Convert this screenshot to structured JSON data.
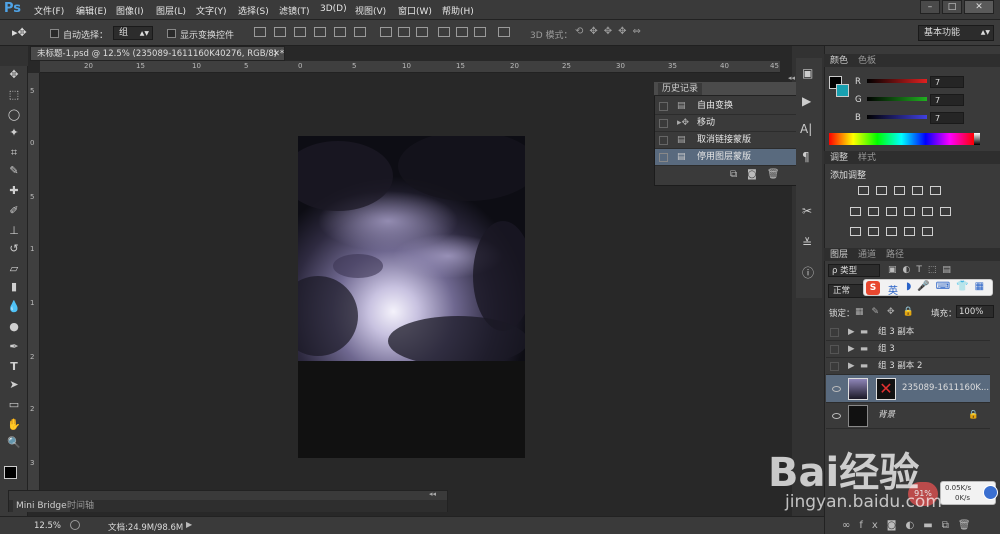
{
  "app": {
    "logo": "Ps"
  },
  "menubar": {
    "items": [
      "文件(F)",
      "编辑(E)",
      "图像(I)",
      "图层(L)",
      "文字(Y)",
      "选择(S)",
      "滤镜(T)",
      "3D(D)",
      "视图(V)",
      "窗口(W)",
      "帮助(H)"
    ],
    "window_buttons": [
      "–",
      "□",
      "✕"
    ]
  },
  "options": {
    "auto_select_label": "自动选择：",
    "auto_select_value": "组",
    "show_transform_label": "显示变换控件",
    "mode3d_label": "3D 模式：",
    "workspace_value": "基本功能"
  },
  "document": {
    "tab_title": "未标题-1.psd @ 12.5% (235089-1611160K40276, RGB/8) *",
    "ruler_h": [
      "20",
      "15",
      "10",
      "5",
      "0",
      "5",
      "10",
      "15",
      "20",
      "25",
      "30",
      "35",
      "40",
      "45"
    ],
    "ruler_v": [
      "5",
      "0",
      "5",
      "1",
      "1",
      "2",
      "2",
      "3"
    ]
  },
  "history": {
    "title": "历史记录",
    "items": [
      {
        "label": "自由变换",
        "selected": false
      },
      {
        "label": "移动",
        "selected": false
      },
      {
        "label": "取消链接蒙版",
        "selected": false
      },
      {
        "label": "停用图层蒙版",
        "selected": true
      }
    ]
  },
  "color_panel": {
    "tabs": [
      "颜色",
      "色板"
    ],
    "channels": [
      {
        "label": "R",
        "value": "7",
        "color": "#e02020"
      },
      {
        "label": "G",
        "value": "7",
        "color": "#20b020"
      },
      {
        "label": "B",
        "value": "7",
        "color": "#4040e0"
      }
    ]
  },
  "adjust_panel": {
    "tabs": [
      "调整",
      "样式"
    ],
    "heading": "添加调整"
  },
  "layers_panel": {
    "tabs": [
      "图层",
      "通道",
      "路径"
    ],
    "kind_label": "ρ 类型",
    "blend_mode": "正常",
    "lock_label": "锁定：",
    "fill_label": "填充：",
    "fill_value": "100%",
    "layers": [
      {
        "name": "组 3 副本",
        "type": "group"
      },
      {
        "name": "组 3",
        "type": "group"
      },
      {
        "name": "组 3 副本 2",
        "type": "group"
      },
      {
        "name": "235089-1611160K...",
        "type": "image"
      },
      {
        "name": "背景",
        "type": "background"
      }
    ]
  },
  "statusbar": {
    "zoom": "12.5%",
    "doc_info": "文档:24.9M/98.6M",
    "tabs": [
      "Mini Bridge",
      "时间轴"
    ]
  },
  "overlays": {
    "ime_label": "英",
    "net_up": "0.05K/s",
    "net_down": "0K/s",
    "cpu": "91%",
    "watermark": "Bai经验",
    "watermark_url": "jingyan.baidu.com"
  }
}
